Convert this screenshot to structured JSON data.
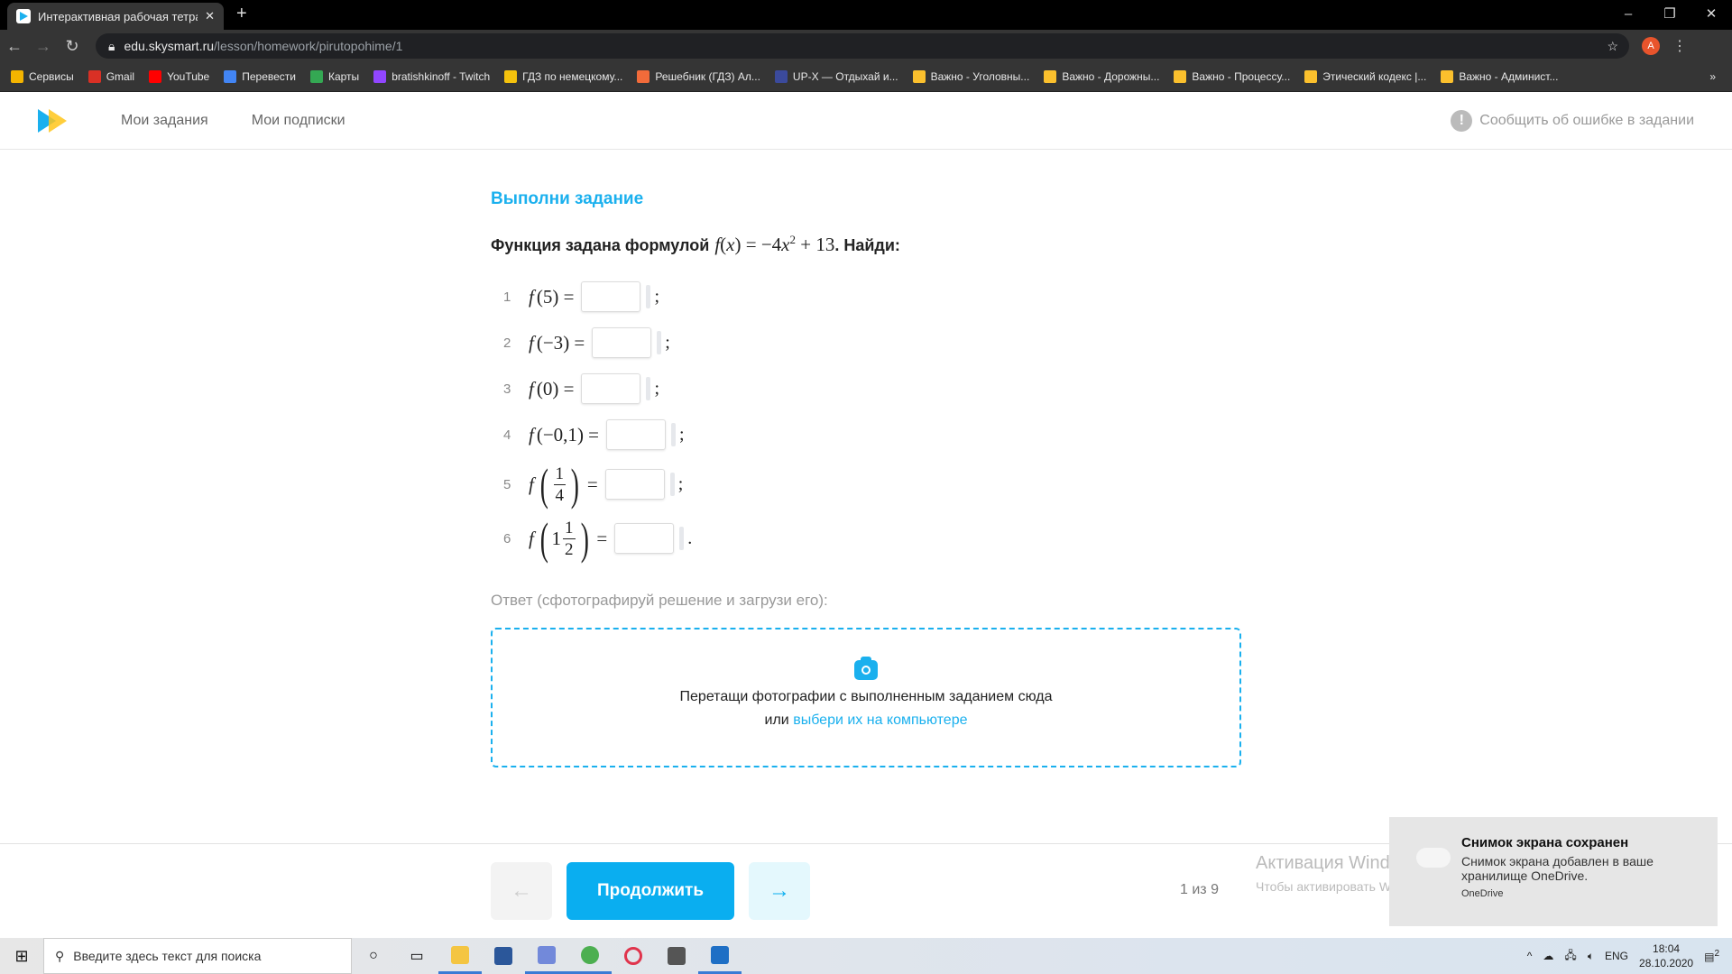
{
  "browser": {
    "tab_title": "Интерактивная рабочая тетрадь",
    "url_host": "edu.skysmart.ru",
    "url_path": "/lesson/homework/pirutopohime/1",
    "profile_initial": "A",
    "bookmarks": [
      {
        "label": "Сервисы",
        "color": "#f4b400"
      },
      {
        "label": "Gmail",
        "color": "#d93025"
      },
      {
        "label": "YouTube",
        "color": "#ff0000"
      },
      {
        "label": "Перевести",
        "color": "#4285f4"
      },
      {
        "label": "Карты",
        "color": "#34a853"
      },
      {
        "label": "bratishkinoff - Twitch",
        "color": "#9146ff"
      },
      {
        "label": "ГДЗ по немецкому...",
        "color": "#f4c20d"
      },
      {
        "label": "Решебник (ГДЗ) Ал...",
        "color": "#f26b3a"
      },
      {
        "label": "UP-X — Отдыхай и...",
        "color": "#3b4a9c"
      },
      {
        "label": "Важно - Уголовны...",
        "color": "#fbc02d"
      },
      {
        "label": "Важно - Дорожны...",
        "color": "#fbc02d"
      },
      {
        "label": "Важно - Процессу...",
        "color": "#fbc02d"
      },
      {
        "label": "Этический кодекс |...",
        "color": "#fbc02d"
      },
      {
        "label": "Важно - Админист...",
        "color": "#fbc02d"
      }
    ]
  },
  "header": {
    "nav": [
      "Мои задания",
      "Мои подписки"
    ],
    "report": "Сообщить об ошибке в задании"
  },
  "task": {
    "title": "Выполни задание",
    "lead": "Функция задана формулой",
    "end": ". Найди:",
    "items": [
      {
        "n": "1",
        "arg": "5",
        "punct": ";"
      },
      {
        "n": "2",
        "arg": "−3",
        "punct": ";"
      },
      {
        "n": "3",
        "arg": "0",
        "punct": ";"
      },
      {
        "n": "4",
        "arg": "−0,1",
        "punct": ";"
      },
      {
        "n": "5",
        "num": "1",
        "den": "4",
        "punct": ";"
      },
      {
        "n": "6",
        "whole": "1",
        "num": "1",
        "den": "2",
        "punct": "."
      }
    ]
  },
  "answer": {
    "label": "Ответ (сфотографируй решение и загрузи его):",
    "drop_text": "Перетащи фотографии с выполненным заданием сюда",
    "or": "или",
    "link": "выбери их на компьютере"
  },
  "footer": {
    "continue": "Продолжить",
    "prev": "←",
    "next": "→",
    "pager": "1 из 9"
  },
  "watermark": {
    "title": "Активация Windows",
    "sub": "Чтобы активировать Windows, перейдите в раздел \"Параметры\"."
  },
  "toast": {
    "title": "Снимок экрана сохранен",
    "body": "Снимок экрана добавлен в ваше хранилище OneDrive.",
    "source": "OneDrive"
  },
  "taskbar": {
    "search_placeholder": "Введите здесь текст для поиска",
    "lang": "ENG",
    "time": "18:04",
    "date": "28.10.2020",
    "notifications": "2"
  },
  "colors": {
    "accent": "#1ab0ee",
    "button": "#0aaef0"
  }
}
